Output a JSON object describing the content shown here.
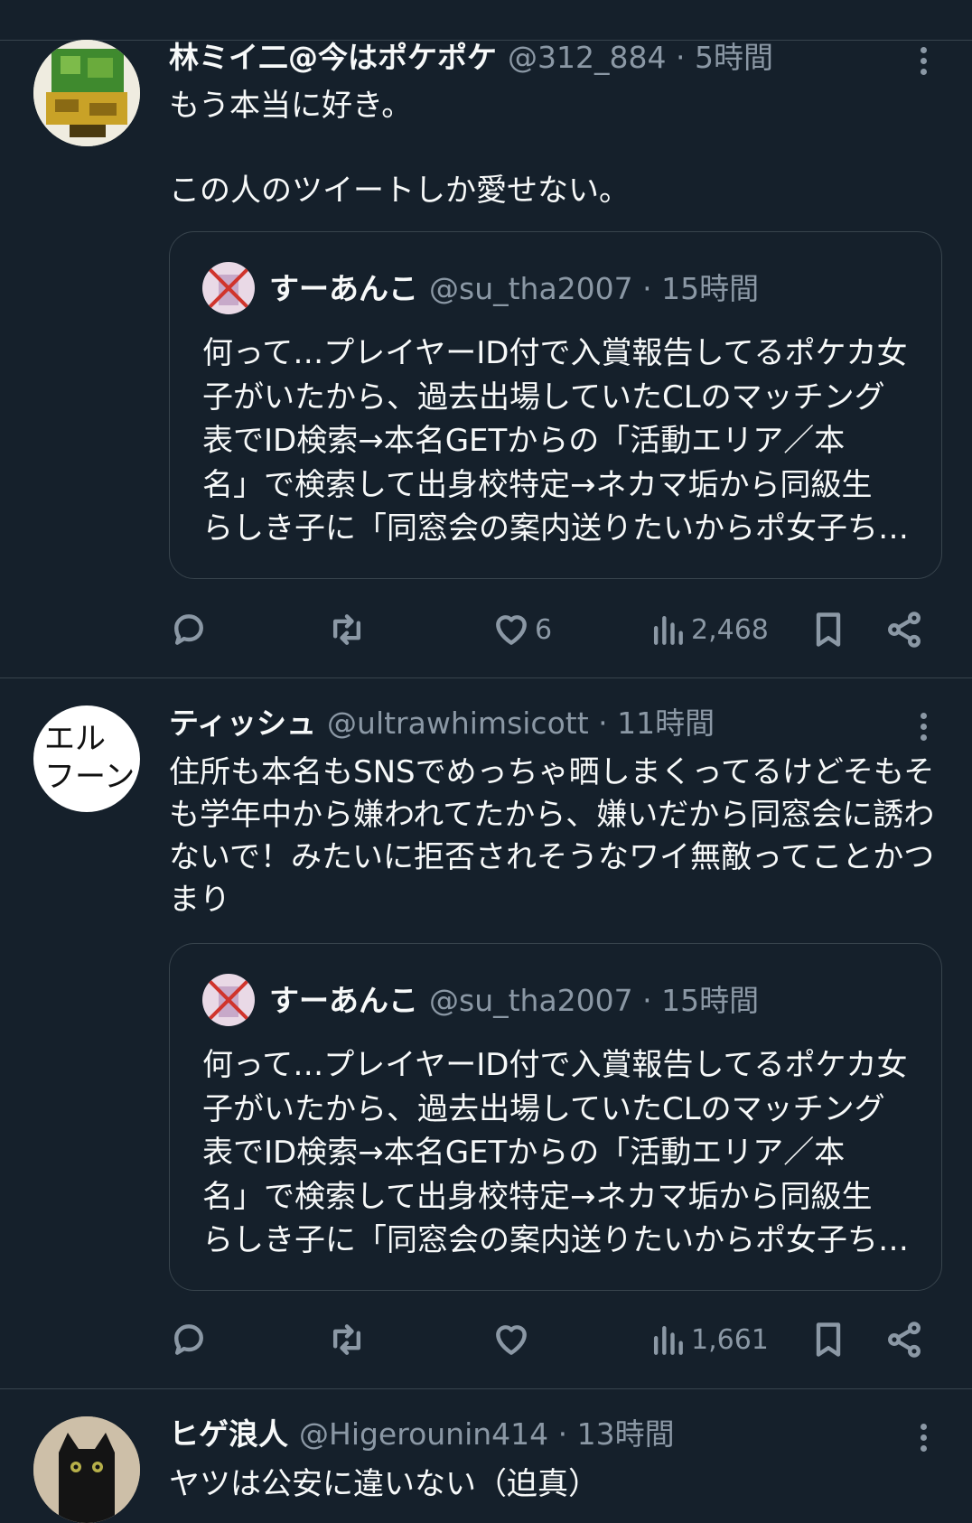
{
  "colors": {
    "background": "#15202b",
    "text": "#f7f9f9",
    "secondary": "#8b98a5",
    "border": "#38444d"
  },
  "tweets": [
    {
      "name": "林ミイ二@今はポケポケ",
      "handle": "@312_884",
      "time": "5時間",
      "text": "もう本当に好き。\n\nこの人のツイートしか愛せない。",
      "quote": {
        "name": "すーあんこ",
        "handle": "@su_tha2007",
        "time": "15時間",
        "text": "何って…プレイヤーID付で入賞報告してるポケカ女\n子がいたから、過去出場していたCLのマッチング\n表でID検索→本名GETからの「活動エリア／本\n名」で検索して出身校特定→ネカマ垢から同級生\nらしき子に「同窓会の案内送りたいからポ女子ち…"
      },
      "likes": "6",
      "views": "2,468"
    },
    {
      "name": "ティッシュ",
      "handle": "@ultrawhimsicott",
      "time": "11時間",
      "avatar_text": "エル\nフーン",
      "text": "住所も本名もSNSでめっちゃ晒しまくってるけどそもそ\nも学年中から嫌われてたから、嫌いだから同窓会に誘わ\nないで！みたいに拒否されそうなワイ無敵ってことかつ\nまり",
      "quote": {
        "name": "すーあんこ",
        "handle": "@su_tha2007",
        "time": "15時間",
        "text": "何って…プレイヤーID付で入賞報告してるポケカ女\n子がいたから、過去出場していたCLのマッチング\n表でID検索→本名GETからの「活動エリア／本\n名」で検索して出身校特定→ネカマ垢から同級生\nらしき子に「同窓会の案内送りたいからポ女子ち…"
      },
      "likes": "",
      "views": "1,661"
    },
    {
      "name": "ヒゲ浪人",
      "handle": "@Higerounin414",
      "time": "13時間",
      "text": "ヤツは公安に違いない（迫真）"
    }
  ]
}
